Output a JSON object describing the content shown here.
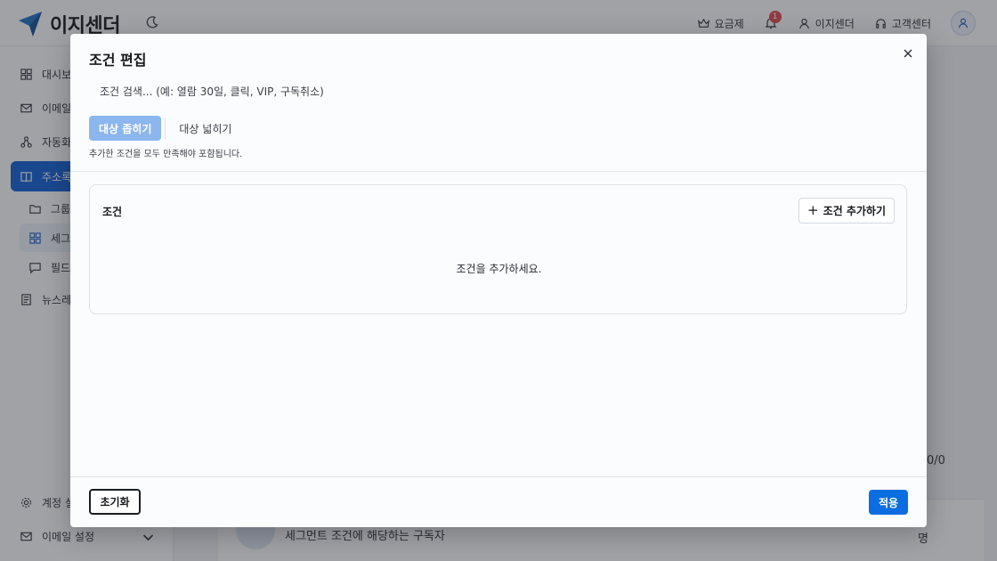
{
  "app": {
    "name": "이지센더",
    "brand_color": "#0f5fd7"
  },
  "header": {
    "items": [
      {
        "label": "요금제",
        "icon": "crown-icon"
      },
      {
        "label": "이지센더",
        "icon": "user-icon"
      },
      {
        "label": "고객센터",
        "icon": "headset-icon"
      }
    ],
    "notification_count": "1"
  },
  "sidebar": {
    "items": [
      {
        "label": "대시보드",
        "icon": "dashboard-icon"
      },
      {
        "label": "이메일",
        "icon": "mail-icon"
      },
      {
        "label": "자동화",
        "icon": "automation-icon"
      },
      {
        "label": "주소록",
        "icon": "book-icon",
        "active": true
      },
      {
        "label": "그룹",
        "icon": "folder-icon"
      },
      {
        "label": "세그먼트",
        "icon": "grid-icon",
        "selected": true
      },
      {
        "label": "필드",
        "icon": "chat-icon"
      },
      {
        "label": "뉴스레터",
        "icon": "newsletter-icon"
      }
    ],
    "bottom": [
      {
        "label": "계정 설정",
        "icon": "gear-icon"
      },
      {
        "label": "이메일 설정",
        "icon": "mail-icon"
      }
    ]
  },
  "main": {
    "counter": "0/0",
    "row_text": "세그먼트 조건에 해당하는 구독자",
    "row_unit": "명"
  },
  "modal": {
    "title": "조건 편집",
    "search_placeholder": "조건 검색... (예: 열람 30일, 클릭, VIP, 구독취소)",
    "mode_narrow": "대상 좁히기",
    "mode_broaden": "대상 넓히기",
    "hint": "추가한 조건을 모두 만족해야 포함됩니다.",
    "conditions_label": "조건",
    "add_condition": "조건 추가하기",
    "empty_message": "조건을 추가하세요.",
    "reset": "초기화",
    "apply": "적용"
  }
}
